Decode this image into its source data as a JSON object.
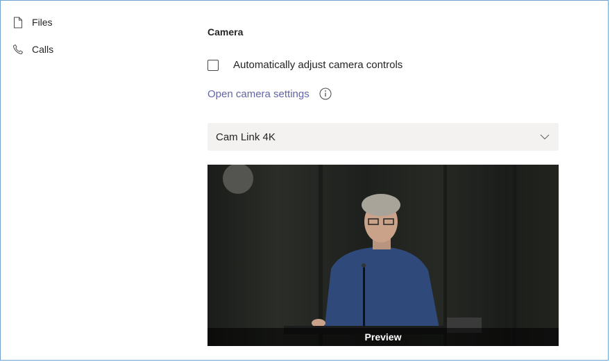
{
  "nav": {
    "items": [
      {
        "label": "Files",
        "icon": "file-icon"
      },
      {
        "label": "Calls",
        "icon": "phone-icon"
      }
    ]
  },
  "camera": {
    "heading": "Camera",
    "auto_adjust_label": "Automatically adjust camera controls",
    "auto_adjust_checked": false,
    "open_settings_link": "Open camera settings",
    "device_selected": "Cam Link 4K",
    "preview_label": "Preview"
  },
  "colors": {
    "border": "#6fa0cf",
    "link": "#6264a7",
    "select_bg": "#f3f2f1"
  }
}
